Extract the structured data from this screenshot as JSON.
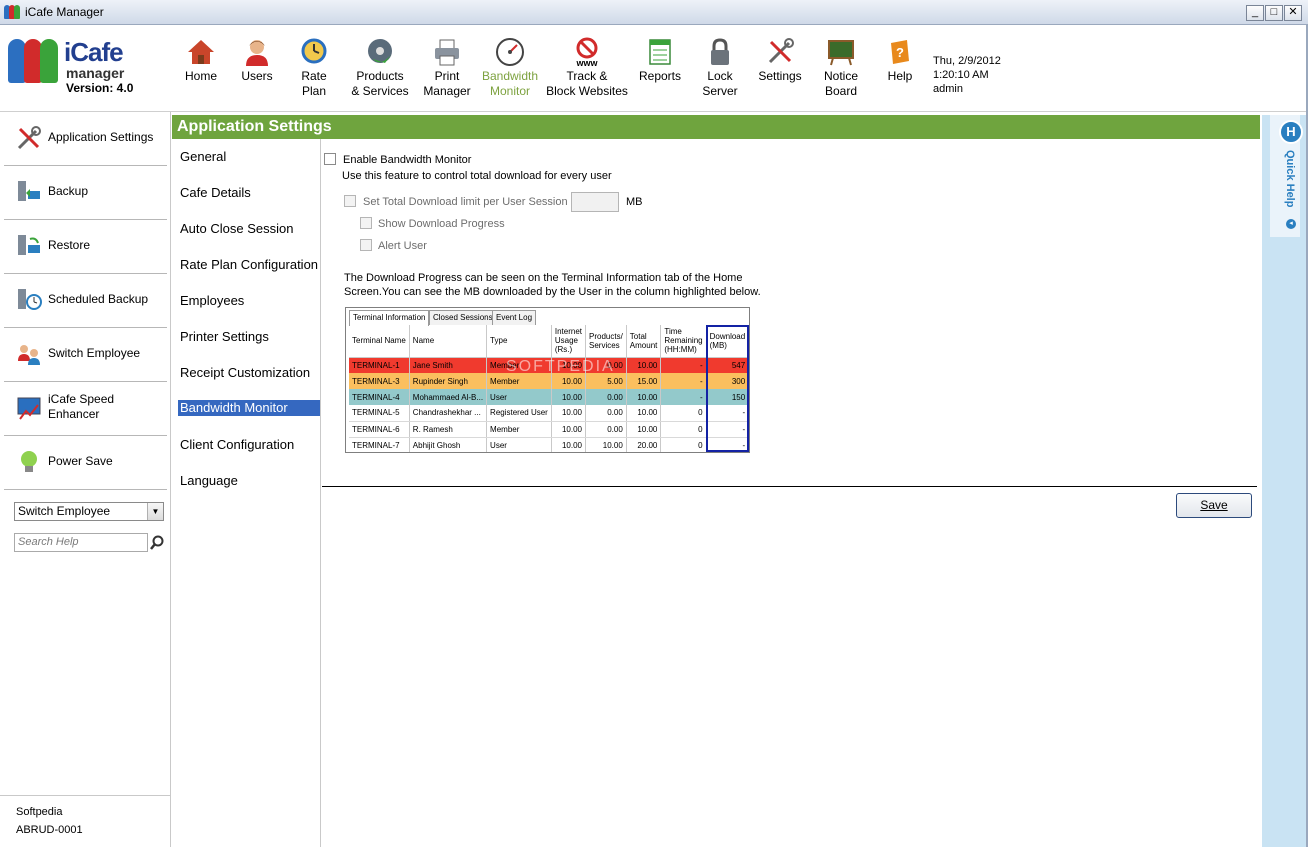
{
  "window": {
    "title": "iCafe Manager",
    "minimize": "_",
    "maximize": "□",
    "close": "✕"
  },
  "logo": {
    "brand": "iCafe",
    "brand_sub": "manager",
    "version": "Version: 4.0"
  },
  "toolbar": {
    "items": [
      {
        "label1": "Home",
        "label2": ""
      },
      {
        "label1": "Users",
        "label2": ""
      },
      {
        "label1": "Rate",
        "label2": "Plan"
      },
      {
        "label1": "Products",
        "label2": "& Services"
      },
      {
        "label1": "Print",
        "label2": "Manager"
      },
      {
        "label1": "Bandwidth",
        "label2": "Monitor"
      },
      {
        "label1": "Track &",
        "label2": "Block Websites"
      },
      {
        "label1": "Reports",
        "label2": ""
      },
      {
        "label1": "Lock",
        "label2": "Server"
      },
      {
        "label1": "Settings",
        "label2": ""
      },
      {
        "label1": "Notice",
        "label2": "Board"
      },
      {
        "label1": "Help",
        "label2": ""
      }
    ],
    "active_color": "#7da23f",
    "www_text": "www"
  },
  "datetime": {
    "date": "Thu, 2/9/2012",
    "time": "1:20:10 AM",
    "user": "admin"
  },
  "left_panel": {
    "items": [
      {
        "label": "Application Settings",
        "icon": "tools-icon"
      },
      {
        "label": "Backup",
        "icon": "backup-icon"
      },
      {
        "label": "Restore",
        "icon": "restore-icon"
      },
      {
        "label": "Scheduled Backup",
        "icon": "scheduled-backup-icon"
      },
      {
        "label": "Switch Employee",
        "icon": "switch-employee-icon"
      },
      {
        "label": "iCafe Speed",
        "label2": "Enhancer",
        "icon": "speed-enhancer-icon"
      },
      {
        "label": "Power Save",
        "icon": "power-save-icon"
      }
    ],
    "employee_select": "Switch Employee",
    "search_placeholder": "Search Help",
    "footer_name": "Softpedia",
    "footer_id": "ABRUD-0001"
  },
  "section_header": "Application Settings",
  "settings_nav": {
    "items": [
      "General",
      "Cafe Details",
      "Auto Close Session",
      "Rate Plan Configuration",
      "Employees",
      "Printer Settings",
      "Receipt Customization",
      "Bandwidth Monitor",
      "Client Configuration",
      "Language"
    ],
    "active": "Bandwidth Monitor"
  },
  "bandwidth": {
    "enable_label": "Enable Bandwidth Monitor",
    "enable_desc": "Use this feature to control total download for every user",
    "limit_label": "Set Total Download limit per User Session",
    "limit_value": "",
    "limit_unit": "MB",
    "show_progress_label": "Show Download Progress",
    "alert_label": "Alert User",
    "note_line1": "The Download Progress can be seen on the Terminal Information tab of the Home",
    "note_line2": "Screen.You can see the MB downloaded by the User in the column highlighted below."
  },
  "sample": {
    "tabs": [
      "Terminal Information",
      "Closed Sessions",
      "Event Log"
    ],
    "headers": [
      "Terminal Name",
      "Name",
      "Type",
      "Internet Usage (Rs.)",
      "Products/ Services",
      "Total Amount",
      "Time Remaining (HH:MM)",
      "Download (MB)"
    ],
    "rows": [
      {
        "style": "r-red",
        "cells": [
          "TERMINAL-1",
          "Jane Smith",
          "Member",
          "10.00",
          "0.00",
          "10.00",
          "-",
          "547"
        ]
      },
      {
        "style": "r-orange",
        "cells": [
          "TERMINAL-3",
          "Rupinder Singh",
          "Member",
          "10.00",
          "5.00",
          "15.00",
          "-",
          "300"
        ]
      },
      {
        "style": "r-teal",
        "cells": [
          "TERMINAL-4",
          "Mohammaed Al-B...",
          "User",
          "10.00",
          "0.00",
          "10.00",
          "-",
          "150"
        ]
      },
      {
        "style": "r-white",
        "cells": [
          "TERMINAL-5",
          "Chandrashekhar ...",
          "Registered User",
          "10.00",
          "0.00",
          "10.00",
          "0",
          "-"
        ]
      },
      {
        "style": "r-white",
        "cells": [
          "TERMINAL-6",
          "R. Ramesh",
          "Member",
          "10.00",
          "0.00",
          "10.00",
          "0",
          "-"
        ]
      },
      {
        "style": "r-white",
        "cells": [
          "TERMINAL-7",
          "Abhijit Ghosh",
          "User",
          "10.00",
          "10.00",
          "20.00",
          "0",
          "-"
        ]
      }
    ],
    "watermark": "SOFTPEDIA"
  },
  "save_label": "Save",
  "quick_help": {
    "badge": "H",
    "label": "Quick Help",
    "arrow": "◂"
  },
  "colors": {
    "header_green": "#6fa43e",
    "nav_active": "#3568c0",
    "quick_help_bg": "#c9e3f3",
    "highlight_box": "#1322a4"
  }
}
